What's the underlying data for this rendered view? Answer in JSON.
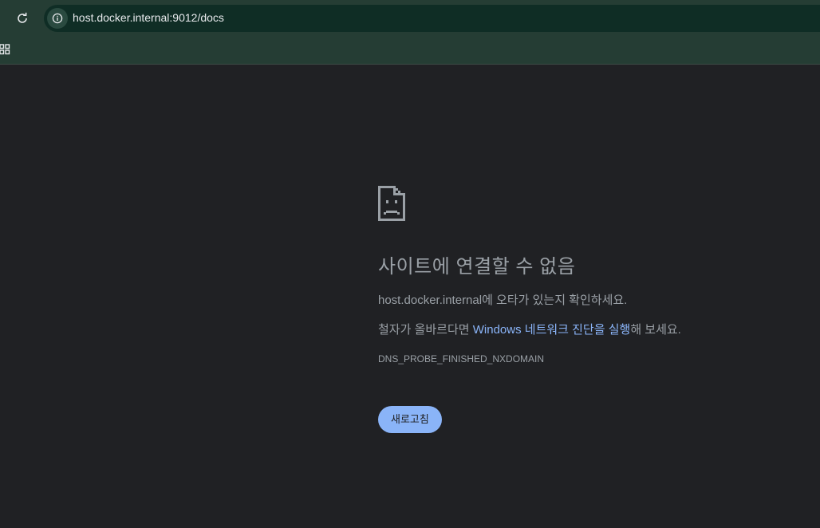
{
  "browser": {
    "url": "host.docker.internal:9012/docs"
  },
  "error": {
    "headline": "사이트에 연결할 수 없음",
    "host": "host.docker.internal",
    "typo_suffix": "에 오타가 있는지 확인하세요.",
    "spelling_prefix": "철자가 올바르다면 ",
    "diagnostics_link": "Windows 네트워크 진단을 실행",
    "spelling_suffix": "해 보세요.",
    "error_code": "DNS_PROBE_FINISHED_NXDOMAIN",
    "reload_label": "새로고침"
  },
  "icons": {
    "reload": "reload-icon",
    "site_info": "info-icon",
    "apps": "apps-grid-icon",
    "error_page": "sad-document-icon"
  },
  "colors": {
    "page_bg": "#202124",
    "toolbar_bg": "#253d34",
    "omnibox_bg": "#0f2d25",
    "text_muted": "#9aa0a6",
    "link": "#8ab4f8",
    "button_bg": "#8ab4f8"
  }
}
